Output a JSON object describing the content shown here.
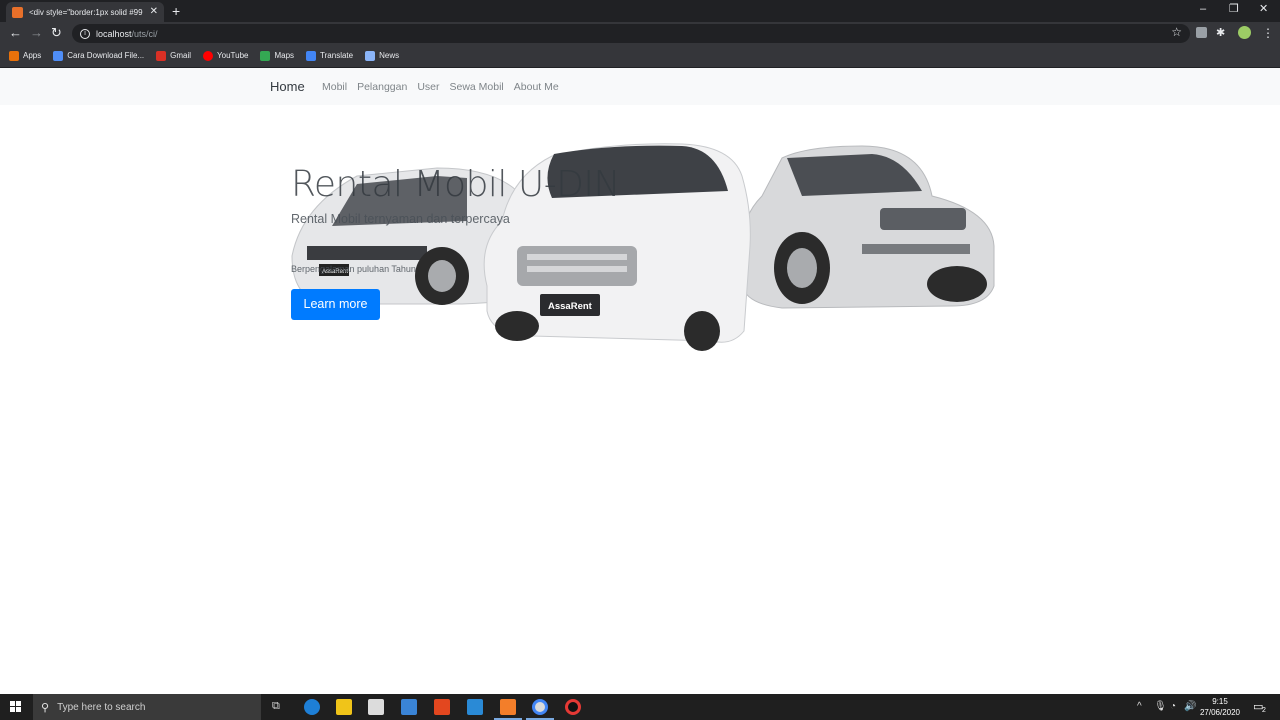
{
  "browser": {
    "tab_title": "<div style=\"border:1px solid #99",
    "tab_close": "✕",
    "new_tab": "+",
    "url_host": "localhost",
    "url_path": "/uts/ci/",
    "window_controls": {
      "minimize": "–",
      "maximize": "❐",
      "close": "✕"
    }
  },
  "bookmarks": [
    {
      "label": "Apps",
      "icon": "apps-grid-icon",
      "color": "#e8710a"
    },
    {
      "label": "Cara Download File...",
      "icon": "site-icon",
      "color": "#4f8ef7"
    },
    {
      "label": "Gmail",
      "icon": "gmail-icon",
      "color": "#d93025"
    },
    {
      "label": "YouTube",
      "icon": "youtube-icon",
      "color": "#ff0000"
    },
    {
      "label": "Maps",
      "icon": "maps-icon",
      "color": "#34a853"
    },
    {
      "label": "Translate",
      "icon": "translate-icon",
      "color": "#4285f4"
    },
    {
      "label": "News",
      "icon": "news-icon",
      "color": "#8ab4f8"
    }
  ],
  "navbar": {
    "brand": "Home",
    "links": [
      "Mobil",
      "Pelanggan",
      "User",
      "Sewa Mobil",
      "About Me"
    ]
  },
  "hero": {
    "title": "Rental Mobil U-DIN",
    "lead": "Rental Mobil ternyaman dan terpercaya",
    "text": "Berpengalaman puluhan Tahun",
    "button": "Learn more",
    "plate_left": "AssaRent",
    "plate_center": "AssaRent"
  },
  "taskbar": {
    "search_placeholder": "Type here to search",
    "time": "9:15",
    "date": "27/06/2020",
    "notification_count": "2"
  },
  "colors": {
    "primary_button": "#007bff",
    "navbar_bg": "#f8f9fa",
    "chrome_dark": "#202124",
    "chrome_toolbar": "#35363a"
  }
}
